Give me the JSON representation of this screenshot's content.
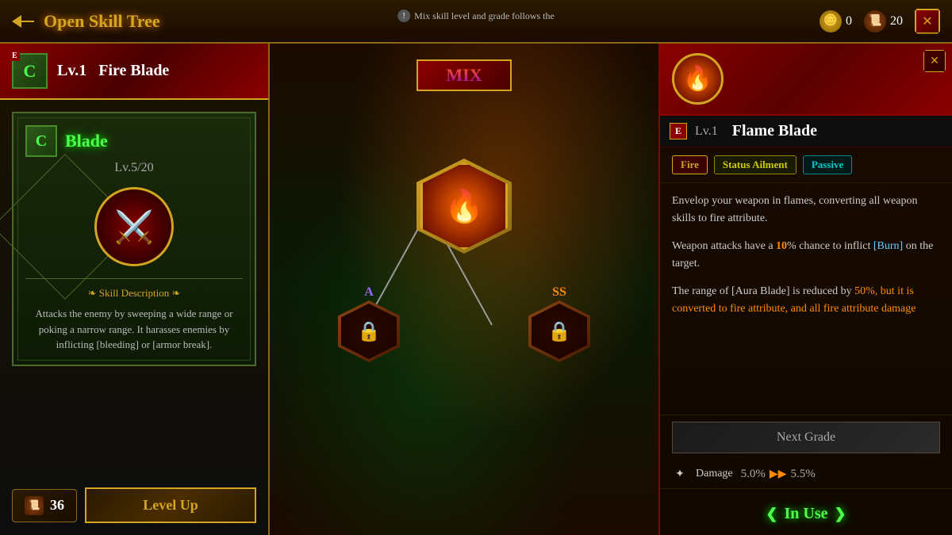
{
  "topbar": {
    "title": "Open Skill Tree",
    "back_label": "Back",
    "resource1_value": "0",
    "resource2_value": "20",
    "close_label": "✕"
  },
  "skill_header": {
    "grade": "C",
    "grade_prefix": "E",
    "level": "Lv.1",
    "name": "Fire Blade"
  },
  "mix_notice": {
    "text": "Mix skill level and grade follows the"
  },
  "skill_card": {
    "grade": "C",
    "name": "Blade",
    "level": "Lv.5/20",
    "description": "Attacks the enemy by sweeping a wide range or poking a narrow range. It harasses enemies by inflicting [bleeding] or [armor break].",
    "desc_title": "❧ Skill Description ❧",
    "scroll_cost": "36",
    "level_up_label": "Level Up"
  },
  "mix_label": "MIX",
  "tree_nodes": {
    "node_a_grade": "A",
    "node_ss_grade": "SS",
    "lock_icon": "🔒"
  },
  "right_panel": {
    "skill_icon": "🔥",
    "close_label": "✕",
    "grade_prefix": "E",
    "level": "Lv.1",
    "skill_name": "Flame Blade",
    "tags": {
      "fire": "Fire",
      "status": "Status Ailment",
      "passive": "Passive"
    },
    "description1": "Envelop your weapon in flames, converting all weapon skills to fire attribute.",
    "description2_prefix": "Weapon attacks have a ",
    "description2_percent": "10",
    "description2_suffix": "% chance to inflict ",
    "description2_burn": "[Burn]",
    "description2_end": " on the target.",
    "description3_prefix": "The range of [Aura Blade] is reduced by ",
    "description3_percent": "50",
    "description3_suffix": "%, but it is converted to fire attribute, and all fire attribute damage",
    "next_grade_label": "Next Grade",
    "damage_label": "Damage",
    "damage_from": "5.0%",
    "damage_arrow": "▶▶",
    "damage_to": "5.5%",
    "in_use_prefix": "❮",
    "in_use_text": "In Use",
    "in_use_suffix": "❯"
  }
}
